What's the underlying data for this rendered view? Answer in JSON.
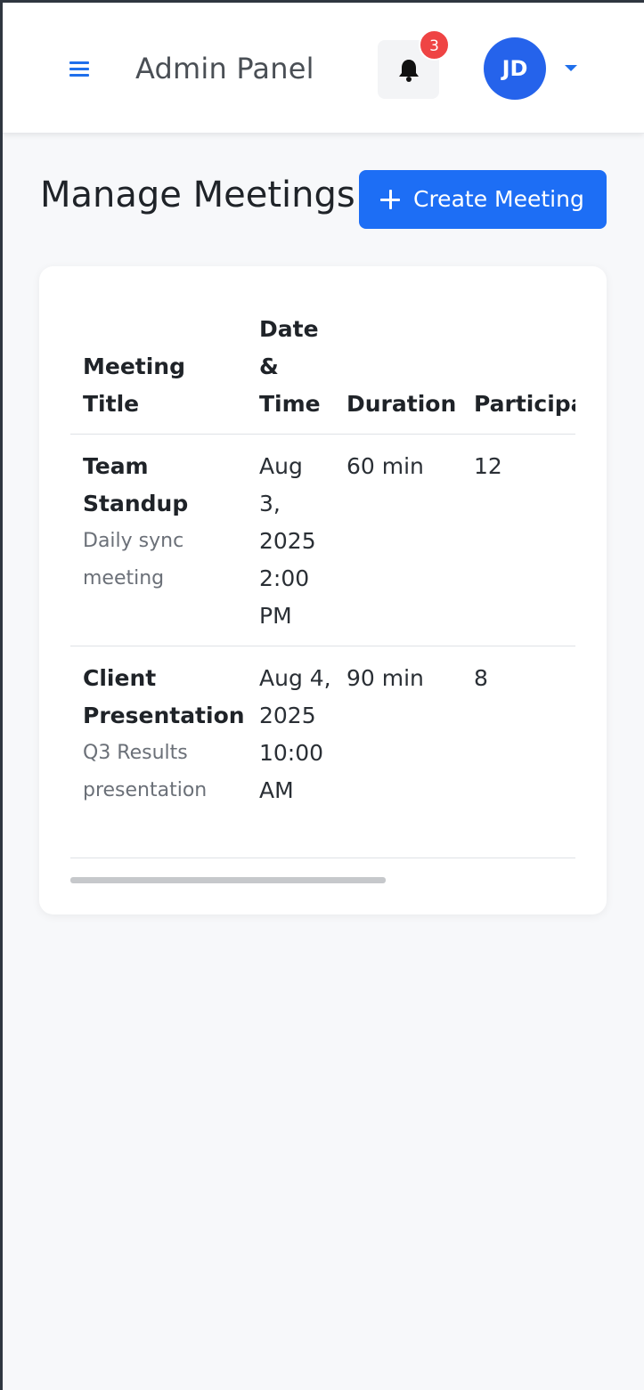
{
  "header": {
    "app_title": "Admin Panel",
    "notifications_count": "3",
    "avatar_initials": "JD"
  },
  "page": {
    "title": "Manage Meetings",
    "create_button_label": "Create Meeting"
  },
  "table": {
    "columns": [
      "Meeting Title",
      "Date & Time",
      "Duration",
      "Participa"
    ],
    "rows": [
      {
        "title": "Team Standup",
        "subtitle": "Daily sync meeting",
        "datetime": "Aug 3, 2025 2:00 PM",
        "duration": "60 min",
        "participants": "12"
      },
      {
        "title": "Client Presentation",
        "subtitle": "Q3 Results presentation",
        "datetime": "Aug 4, 2025 10:00 AM",
        "duration": "90 min",
        "participants": "8"
      }
    ]
  },
  "colors": {
    "accent": "#1d6ef5",
    "badge": "#ef4444",
    "avatar": "#2563eb"
  }
}
